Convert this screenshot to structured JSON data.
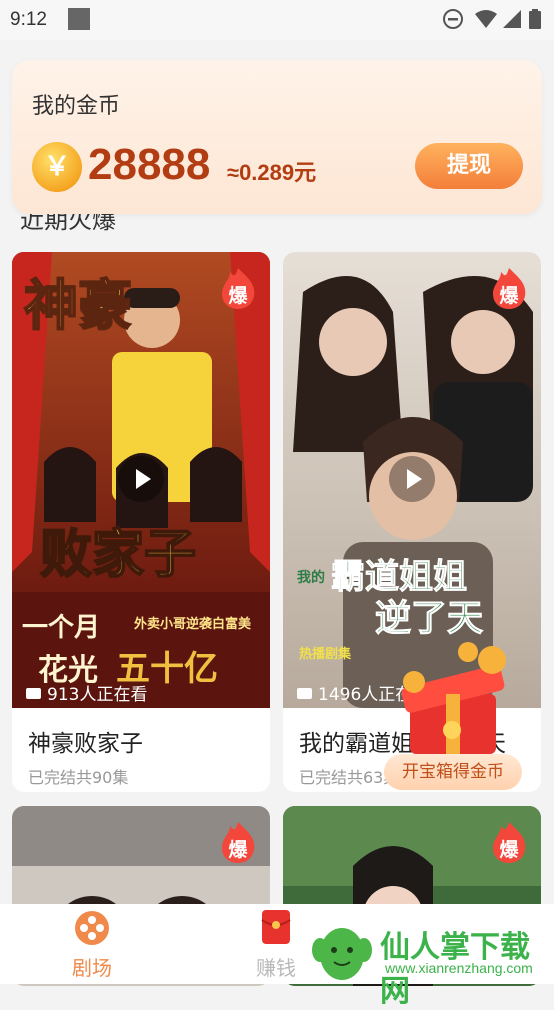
{
  "status": {
    "time": "9:12"
  },
  "coins": {
    "title": "我的金币",
    "coin_symbol": "￥",
    "amount": "28888",
    "rate": "≈0.289元",
    "withdraw_label": "提现"
  },
  "section": {
    "title": "近期火爆"
  },
  "dramas": [
    {
      "title": "神豪败家子",
      "meta": "已完结共90集",
      "viewers": "913人正在看",
      "badge": "爆",
      "poster": {
        "title_top": "神豪",
        "title_main": "败家子",
        "tagline": "外卖小哥逆袭白富美",
        "line1": "一个月",
        "line2": "花光",
        "line3": "五十亿"
      }
    },
    {
      "title": "我的霸道姐姐逆了天",
      "meta": "已完结共63集",
      "viewers": "1496人正在看",
      "badge": "爆",
      "poster": {
        "prefix": "我的",
        "title_main": "霸道姐姐",
        "title_sub": "逆了天",
        "tagline": "热播剧集"
      }
    },
    {
      "badge": "爆"
    },
    {
      "badge": "爆"
    }
  ],
  "treasure": {
    "label": "开宝箱得金币"
  },
  "tabs": [
    {
      "label": "剧场",
      "active": true
    },
    {
      "label": "赚钱",
      "active": false
    }
  ],
  "watermark": {
    "text": "仙人掌下载网",
    "url": "www.xianrenzhang.com"
  },
  "colors": {
    "accent": "#f37e3a",
    "coin_text": "#b23d12",
    "tab_active": "#f08a4b",
    "tab_inactive": "#b9b9b9"
  }
}
